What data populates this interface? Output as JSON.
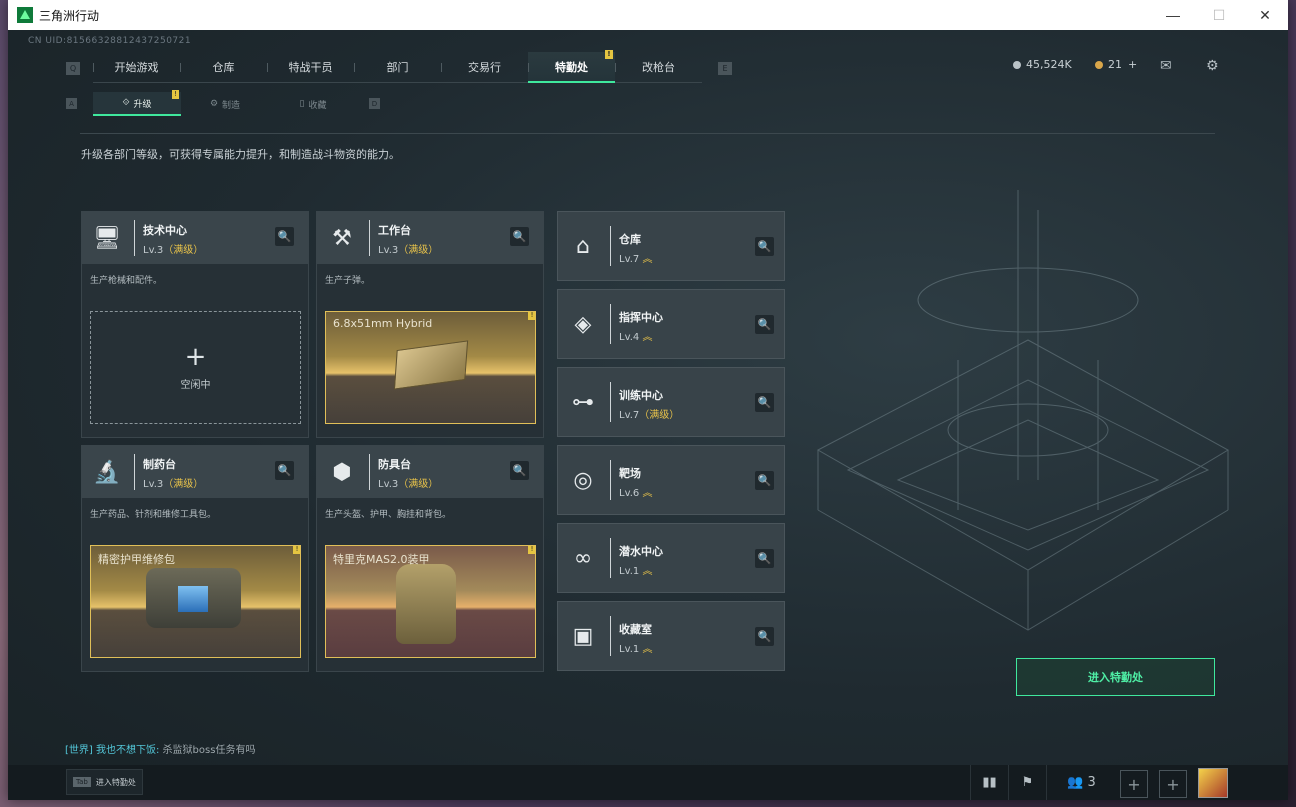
{
  "window": {
    "title": "三角洲行动",
    "controls": [
      "—",
      "☐",
      "✕"
    ]
  },
  "uid": "CN UID:8156632881243725072​1",
  "topnav": {
    "left_key": "Q",
    "right_key": "E",
    "items": [
      {
        "label": "开始游戏"
      },
      {
        "label": "仓库"
      },
      {
        "label": "特战干员"
      },
      {
        "label": "部门"
      },
      {
        "label": "交易行"
      },
      {
        "label": "特勤处",
        "active": true,
        "badge": "!"
      },
      {
        "label": "改枪台"
      }
    ]
  },
  "currency": {
    "coins": "45,524K",
    "tickets": "21",
    "tickets_plus": "+"
  },
  "subnav": {
    "left_key": "A",
    "right_key": "D",
    "items": [
      {
        "label": "升级",
        "active": true,
        "badge": "!"
      },
      {
        "label": "制造"
      },
      {
        "label": "收藏"
      }
    ]
  },
  "description": "升级各部门等级，可获得专属能力提升，和制造战斗物资的能力。",
  "production_cards": [
    {
      "name": "技术中心",
      "level": "Lv.3",
      "max": "（满级）",
      "sub": "生产枪械和配件。",
      "slot": {
        "empty": true,
        "label": "空闲中"
      }
    },
    {
      "name": "工作台",
      "level": "Lv.3",
      "max": "（满级）",
      "sub": "生产子弹。",
      "slot": {
        "empty": false,
        "label": "6.8x51mm Hybrid",
        "badge": "!"
      }
    },
    {
      "name": "制药台",
      "level": "Lv.3",
      "max": "（满级）",
      "sub": "生产药品、针剂和维修工具包。",
      "slot": {
        "empty": false,
        "label": "精密护甲维修包",
        "badge": "!"
      }
    },
    {
      "name": "防具台",
      "level": "Lv.3",
      "max": "（满级）",
      "sub": "生产头盔、护甲、胸挂和背包。",
      "slot": {
        "empty": false,
        "label": "特里克MAS2.0装甲",
        "badge": "!"
      }
    }
  ],
  "building_cards": [
    {
      "name": "仓库",
      "level": "Lv.7",
      "max": "",
      "chev": "︽"
    },
    {
      "name": "指挥中心",
      "level": "Lv.4",
      "max": "",
      "chev": "︽"
    },
    {
      "name": "训练中心",
      "level": "Lv.7",
      "max": "（满级）",
      "chev": ""
    },
    {
      "name": "靶场",
      "level": "Lv.6",
      "max": "",
      "chev": "︽"
    },
    {
      "name": "潜水中心",
      "level": "Lv.1",
      "max": "",
      "chev": "︽"
    },
    {
      "name": "收藏室",
      "level": "Lv.1",
      "max": "",
      "chev": "︽"
    }
  ],
  "enter_button": "进入特勤处",
  "chat": {
    "channel": "[世界]",
    "name": "我也不想下饭:",
    "message": "杀监狱boss任务有吗"
  },
  "bottombar": {
    "tab_key": "Tab",
    "tab_label": "进入特勤处",
    "friends_count": "3",
    "plus": "+"
  },
  "icons": {
    "search": "🔍",
    "mail": "✉",
    "settings": "⚙"
  },
  "colors": {
    "accent": "#3fe89d",
    "gold": "#e7c24a",
    "badge": "#e5c541"
  }
}
